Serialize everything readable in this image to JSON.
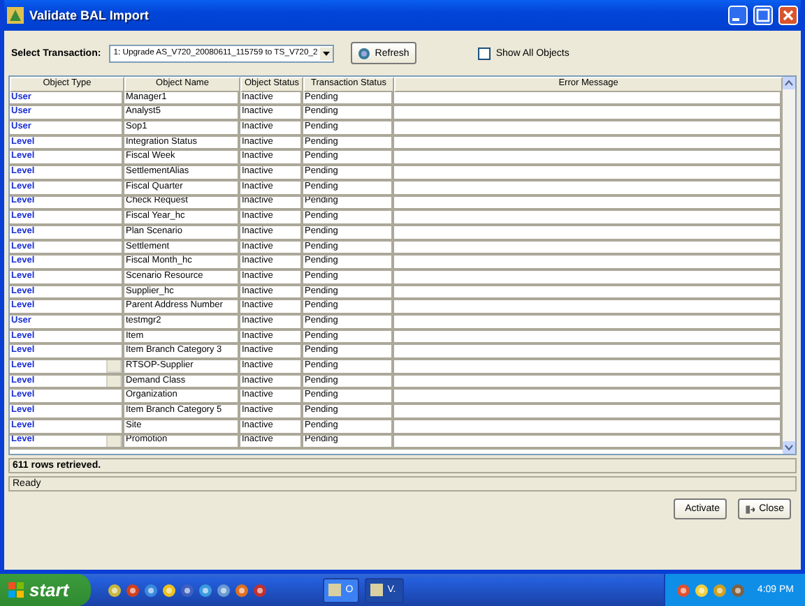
{
  "window": {
    "title": "Validate BAL Import"
  },
  "toolbar": {
    "label": "Select Transaction:",
    "transaction": "1: Upgrade AS_V720_20080611_115759 to TS_V720_2",
    "refresh_button": "Refresh",
    "show_all": {
      "label": "Show All Objects",
      "checked": false
    }
  },
  "table": {
    "columns": [
      "Object Type",
      "Object Name",
      "Object Status",
      "Transaction Status",
      "Error Message"
    ],
    "rows": [
      {
        "type": "User",
        "name": "Manager1",
        "status": "Inactive",
        "transaction": "Pending",
        "button": false
      },
      {
        "type": "User",
        "name": "Analyst5",
        "status": "Inactive",
        "transaction": "Pending",
        "button": false
      },
      {
        "type": "User",
        "name": "Sop1",
        "status": "Inactive",
        "transaction": "Pending",
        "button": false
      },
      {
        "type": "Level",
        "name": "Integration Status",
        "status": "Inactive",
        "transaction": "Pending",
        "button": false
      },
      {
        "type": "Level",
        "name": "Fiscal Week",
        "status": "Inactive",
        "transaction": "Pending",
        "button": false
      },
      {
        "type": "Level",
        "name": "SettlementAlias",
        "status": "Inactive",
        "transaction": "Pending",
        "button": false
      },
      {
        "type": "Level",
        "name": "Fiscal Quarter",
        "status": "Inactive",
        "transaction": "Pending",
        "button": false
      },
      {
        "type": "Level",
        "name": "Check Request",
        "status": "Inactive",
        "transaction": "Pending",
        "button": false
      },
      {
        "type": "Level",
        "name": "Fiscal Year_hc",
        "status": "Inactive",
        "transaction": "Pending",
        "button": false
      },
      {
        "type": "Level",
        "name": "Plan Scenario",
        "status": "Inactive",
        "transaction": "Pending",
        "button": false
      },
      {
        "type": "Level",
        "name": "Settlement",
        "status": "Inactive",
        "transaction": "Pending",
        "button": false
      },
      {
        "type": "Level",
        "name": "Fiscal Month_hc",
        "status": "Inactive",
        "transaction": "Pending",
        "button": false
      },
      {
        "type": "Level",
        "name": "Scenario Resource",
        "status": "Inactive",
        "transaction": "Pending",
        "button": false
      },
      {
        "type": "Level",
        "name": "Supplier_hc",
        "status": "Inactive",
        "transaction": "Pending",
        "button": false
      },
      {
        "type": "Level",
        "name": "Parent Address Number",
        "status": "Inactive",
        "transaction": "Pending",
        "button": false
      },
      {
        "type": "User",
        "name": "testmgr2",
        "status": "Inactive",
        "transaction": "Pending",
        "button": false
      },
      {
        "type": "Level",
        "name": "Item",
        "status": "Inactive",
        "transaction": "Pending",
        "button": false
      },
      {
        "type": "Level",
        "name": "Item Branch Category 3",
        "status": "Inactive",
        "transaction": "Pending",
        "button": false
      },
      {
        "type": "Level",
        "name": "RTSOP-Supplier",
        "status": "Inactive",
        "transaction": "Pending",
        "button": true
      },
      {
        "type": "Level",
        "name": "Demand Class",
        "status": "Inactive",
        "transaction": "Pending",
        "button": true
      },
      {
        "type": "Level",
        "name": "Organization",
        "status": "Inactive",
        "transaction": "Pending",
        "button": false
      },
      {
        "type": "Level",
        "name": "Item Branch Category 5",
        "status": "Inactive",
        "transaction": "Pending",
        "button": false
      },
      {
        "type": "Level",
        "name": "Site",
        "status": "Inactive",
        "transaction": "Pending",
        "button": false
      },
      {
        "type": "Level",
        "name": "Promotion",
        "status": "Inactive",
        "transaction": "Pending",
        "button": true
      }
    ]
  },
  "status": {
    "count": "611 rows retrieved.",
    "state": "Ready"
  },
  "buttons": [
    {
      "label": "Activate",
      "kind": "activate"
    },
    {
      "label": "Close",
      "kind": "close"
    }
  ],
  "taskbar": {
    "start": "start",
    "tasks": [
      {
        "label": "O",
        "selected": false
      },
      {
        "label": "V.",
        "selected": true
      }
    ],
    "clock": "4:09 PM"
  }
}
